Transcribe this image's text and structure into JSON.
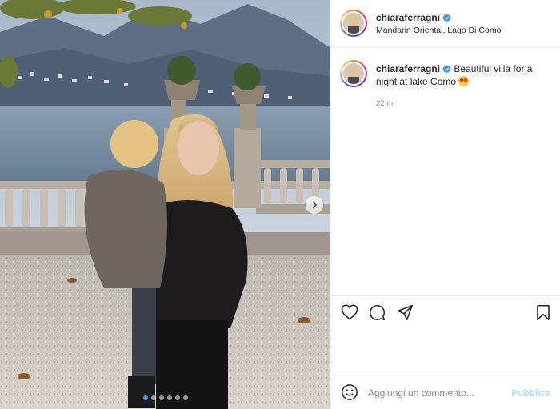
{
  "post": {
    "author": {
      "username": "chiaraferragni",
      "verified": true,
      "location": "Mandarin Oriental, Lago Di Como"
    },
    "caption": {
      "username": "chiaraferragni",
      "text": "Beautiful villa for a night at lake Como",
      "emoji": "star-struck-emoji"
    },
    "time": "22 m",
    "carousel": {
      "count": 6,
      "active": 1
    }
  },
  "actions": {
    "like_icon": "heart-icon",
    "comment_icon": "comment-icon",
    "share_icon": "paper-plane-icon",
    "save_icon": "bookmark-icon"
  },
  "comment": {
    "placeholder": "Aggiungi un commento...",
    "publish_label": "Pubblica"
  },
  "colors": {
    "verified": "#3897f0",
    "publish_disabled": "#b2dffc",
    "secondary_text": "#8e8e8e"
  }
}
